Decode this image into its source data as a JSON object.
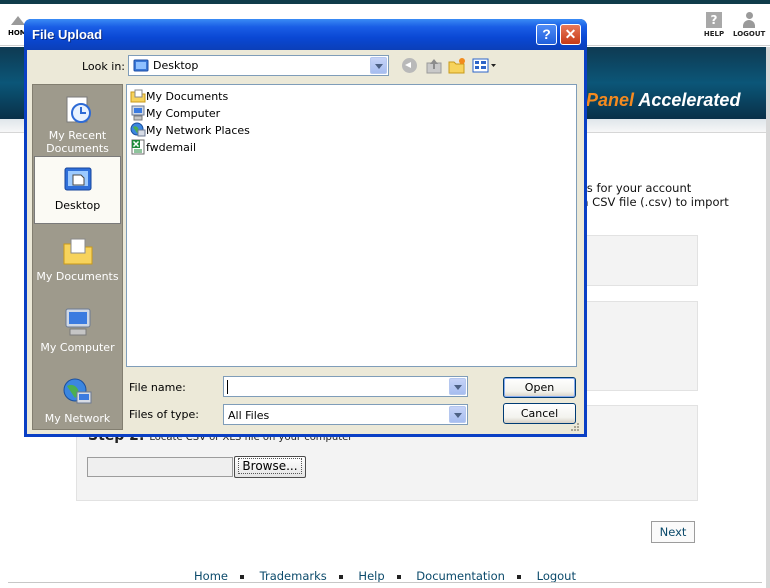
{
  "page": {
    "topbar": {
      "home_label": "HOME",
      "help_label": "HELP",
      "logout_label": "LOGOUT"
    },
    "banner": {
      "brand_part": "Panel",
      "accelerated": "Accelerated"
    },
    "intro_lines": [
      "ers for your account",
      "ka CSV file (.csv) to import"
    ],
    "step2": {
      "title": "Step 2:",
      "text": "Locate CSV or XLS file on your computer"
    },
    "browse_label": "Browse...",
    "next_label": "Next",
    "footer": [
      "Home",
      "Trademarks",
      "Help",
      "Documentation",
      "Logout"
    ]
  },
  "dialog": {
    "title": "File Upload",
    "help_glyph": "?",
    "close_glyph": "✕",
    "look_in_label": "Look in:",
    "look_in_value": "Desktop",
    "places": [
      {
        "label": "My Recent Documents",
        "icon": "recent-documents-icon"
      },
      {
        "label": "Desktop",
        "icon": "desktop-icon",
        "selected": true
      },
      {
        "label": "My Documents",
        "icon": "my-documents-icon"
      },
      {
        "label": "My Computer",
        "icon": "my-computer-icon"
      },
      {
        "label": "My Network",
        "icon": "my-network-icon"
      }
    ],
    "files": [
      {
        "name": "My Documents",
        "icon": "folder-icon"
      },
      {
        "name": "My Computer",
        "icon": "computer-icon"
      },
      {
        "name": "My Network Places",
        "icon": "network-icon"
      },
      {
        "name": "fwdemail",
        "icon": "excel-file-icon"
      }
    ],
    "file_name_label": "File name:",
    "file_name_value": "",
    "files_of_type_label": "Files of type:",
    "files_of_type_value": "All Files",
    "open_label": "Open",
    "cancel_label": "Cancel"
  }
}
